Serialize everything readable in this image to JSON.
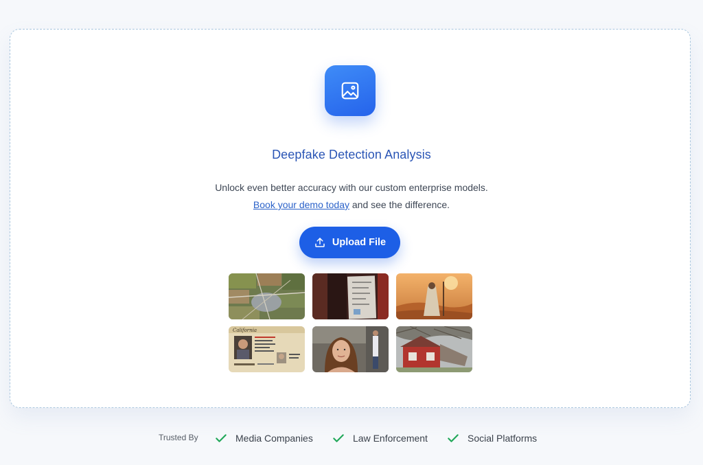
{
  "hero": {
    "icon": "image-icon",
    "title": "Deepfake Detection Analysis",
    "description_before": "Unlock even better accuracy with our custom enterprise models.",
    "demo_link": "Book your demo today",
    "description_after": "and see the difference."
  },
  "upload": {
    "label": "Upload File",
    "icon": "upload-icon"
  },
  "samples": [
    {
      "name": "aerial-satellite-map"
    },
    {
      "name": "dark-room-papers"
    },
    {
      "name": "desert-figure-sunset"
    },
    {
      "name": "california-id-card"
    },
    {
      "name": "woman-portrait-street"
    },
    {
      "name": "damaged-red-house"
    }
  ],
  "trusted": {
    "label": "Trusted By",
    "items": [
      "Media Companies",
      "Law Enforcement",
      "Social Platforms"
    ],
    "check_color": "#22a85a"
  },
  "colors": {
    "accent": "#1d5fe6",
    "title": "#2a55b5",
    "card_border": "#a9c6de"
  }
}
